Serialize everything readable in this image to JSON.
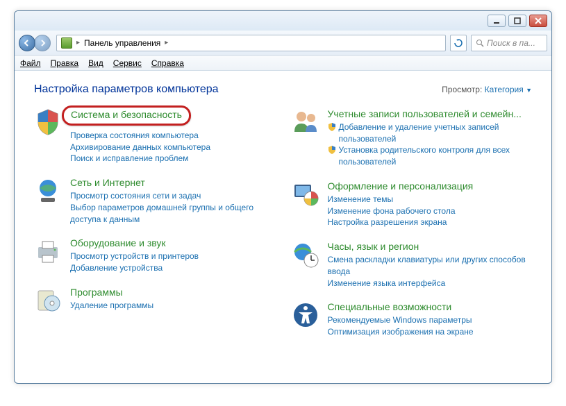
{
  "breadcrumb": {
    "root": "Панель управления"
  },
  "search": {
    "placeholder": "Поиск в па..."
  },
  "menu": {
    "file": "Файл",
    "edit": "Правка",
    "view": "Вид",
    "tools": "Сервис",
    "help": "Справка"
  },
  "heading": "Настройка параметров компьютера",
  "viewby": {
    "label": "Просмотр:",
    "value": "Категория"
  },
  "cats": {
    "system": {
      "title": "Система и безопасность",
      "l1": "Проверка состояния компьютера",
      "l2": "Архивирование данных компьютера",
      "l3": "Поиск и исправление проблем"
    },
    "network": {
      "title": "Сеть и Интернет",
      "l1": "Просмотр состояния сети и задач",
      "l2": "Выбор параметров домашней группы и общего доступа к данным"
    },
    "hardware": {
      "title": "Оборудование и звук",
      "l1": "Просмотр устройств и принтеров",
      "l2": "Добавление устройства"
    },
    "programs": {
      "title": "Программы",
      "l1": "Удаление программы"
    },
    "users": {
      "title": "Учетные записи пользователей и семейн...",
      "l1": "Добавление и удаление учетных записей пользователей",
      "l2": "Установка родительского контроля для всех пользователей"
    },
    "appearance": {
      "title": "Оформление и персонализация",
      "l1": "Изменение темы",
      "l2": "Изменение фона рабочего стола",
      "l3": "Настройка разрешения экрана"
    },
    "clock": {
      "title": "Часы, язык и регион",
      "l1": "Смена раскладки клавиатуры или других способов ввода",
      "l2": "Изменение языка интерфейса"
    },
    "ease": {
      "title": "Специальные возможности",
      "l1": "Рекомендуемые Windows параметры",
      "l2": "Оптимизация изображения на экране"
    }
  }
}
